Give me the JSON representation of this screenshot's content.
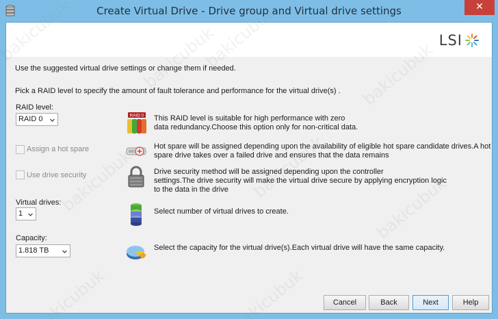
{
  "window": {
    "title": "Create Virtual Drive - Drive group and Virtual drive settings",
    "close_label": "✕",
    "app_icon": "drive-stack-icon"
  },
  "banner": {
    "logo_text": "LSI",
    "logo_icon": "lsi-star-icon"
  },
  "intro": {
    "line1": "Use the suggested virtual drive settings or change them if needed.",
    "line2": "Pick a RAID level to specify the amount of fault tolerance and performance for the virtual drive(s) ."
  },
  "raid": {
    "label": "RAID level:",
    "value": "RAID  0",
    "icon_badge": "RAID 0",
    "icon": "raid0-icon",
    "desc_line1": "This RAID level is suitable for high performance with zero",
    "desc_line2": "data redundancy.Choose this option only for non-critical data."
  },
  "hot_spare": {
    "label": "Assign a hot spare",
    "checked": false,
    "enabled": false,
    "icon": "hot-spare-icon",
    "desc_line1": "Hot spare will be assigned depending upon the availability of eligible hot spare candidate drives.A hot",
    "desc_line2": "spare drive takes over a failed drive and ensures that the data remains"
  },
  "security": {
    "label": "Use drive security",
    "checked": false,
    "enabled": false,
    "icon": "padlock-icon",
    "desc_line1": "Drive security method will be assigned depending upon the controller",
    "desc_line2": "settings.The drive security will make the virtual drive secure by applying encryption logic",
    "desc_line3": "to the data in the drive"
  },
  "virtual_drives": {
    "label": "Virtual drives:",
    "value": "1",
    "icon": "virtual-drives-icon",
    "desc": "Select number of virtual drives to create."
  },
  "capacity": {
    "label": "Capacity:",
    "value": "1.818 TB",
    "icon": "capacity-pie-icon",
    "desc": "Select the capacity for the virtual drive(s).Each virtual drive will have the same capacity."
  },
  "buttons": {
    "cancel": "Cancel",
    "back": "Back",
    "next": "Next",
    "help": "Help"
  },
  "watermark": "bakicubuk"
}
